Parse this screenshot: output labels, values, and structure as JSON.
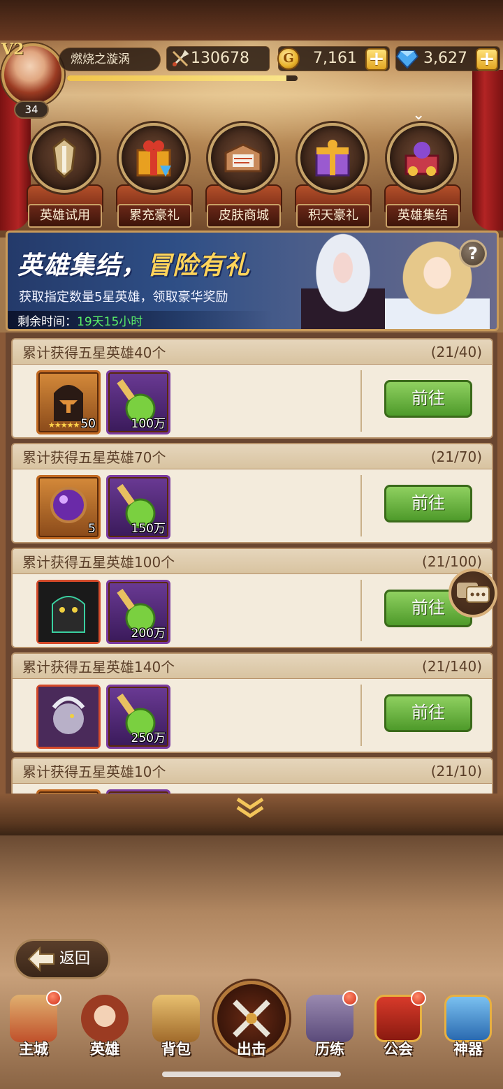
{
  "player": {
    "vip": "V2",
    "level": "34",
    "name": "燃烧之漩涡",
    "power": "130678",
    "exp_progress": 0.95
  },
  "currency": {
    "gold_symbol": "G",
    "gold": "7,161",
    "gems": "3,627",
    "plus": "+"
  },
  "events": [
    {
      "label": "英雄试用",
      "icon": "hero-trial-icon"
    },
    {
      "label": "累充豪礼",
      "icon": "gift-box-icon"
    },
    {
      "label": "皮肤商城",
      "icon": "skin-shop-icon"
    },
    {
      "label": "积天豪礼",
      "icon": "daily-gift-icon"
    },
    {
      "label": "英雄集结",
      "icon": "hero-gather-icon",
      "active": true
    }
  ],
  "banner": {
    "title_a": "英雄集结，",
    "title_b": "冒险有礼",
    "subtitle": "获取指定数量5星英雄，领取豪华奖励",
    "time_label": "剩余时间：",
    "time_value": "19天15小时",
    "help": "?"
  },
  "tasks": [
    {
      "title": "累计获得五星英雄40个",
      "progress": "(21/40)",
      "rewards": [
        {
          "type": "orange",
          "qty": "50",
          "icon": "hero-fragment-icon"
        },
        {
          "type": "purple",
          "qty": "100万",
          "icon": "exp-potion-icon"
        }
      ],
      "button": "前往"
    },
    {
      "title": "累计获得五星英雄70个",
      "progress": "(21/70)",
      "rewards": [
        {
          "type": "orange",
          "qty": "5",
          "icon": "purple-orb-icon"
        },
        {
          "type": "purple",
          "qty": "150万",
          "icon": "exp-potion-icon"
        }
      ],
      "button": "前往"
    },
    {
      "title": "累计获得五星英雄100个",
      "progress": "(21/100)",
      "rewards": [
        {
          "type": "red",
          "qty": "",
          "icon": "dark-hero-icon"
        },
        {
          "type": "purple",
          "qty": "200万",
          "icon": "exp-potion-icon"
        }
      ],
      "button": "前往"
    },
    {
      "title": "累计获得五星英雄140个",
      "progress": "(21/140)",
      "rewards": [
        {
          "type": "red",
          "qty": "",
          "icon": "demon-hero-icon"
        },
        {
          "type": "purple",
          "qty": "250万",
          "icon": "exp-potion-icon"
        }
      ],
      "button": "前往"
    },
    {
      "title": "累计获得五星英雄10个",
      "progress": "(21/10)",
      "rewards": [],
      "button": "前往"
    }
  ],
  "back_button": "返回",
  "nav": [
    {
      "label": "主城",
      "icon": "castle-icon",
      "dot": true
    },
    {
      "label": "英雄",
      "icon": "hero-icon",
      "dot": false
    },
    {
      "label": "背包",
      "icon": "backpack-icon",
      "dot": false
    },
    {
      "label": "出击",
      "icon": "crossed-swords-icon",
      "dot": false
    },
    {
      "label": "历练",
      "icon": "training-icon",
      "dot": true
    },
    {
      "label": "公会",
      "icon": "guild-icon",
      "dot": true
    },
    {
      "label": "神器",
      "icon": "artifact-icon",
      "dot": false
    }
  ],
  "colors": {
    "accent_green": "#5af068",
    "button_green": "#4e9a2a",
    "gold": "#f2c54a"
  }
}
